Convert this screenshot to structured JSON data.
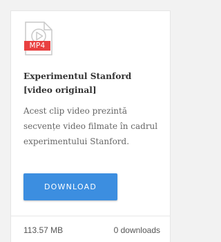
{
  "file_card": {
    "icon": "mp4-file-icon",
    "extension": "MP4",
    "title": "Experimentul Stanford [video original]",
    "description": "Acest clip video prezintă secvențe video filmate în cadrul experimentului Stanford.",
    "download_label": "DOWNLOAD",
    "file_size": "113.57 MB",
    "downloads": "0 downloads"
  },
  "colors": {
    "badge": "#e94040",
    "button": "#3c8ee0",
    "icon_gray": "#c9c9c9"
  }
}
